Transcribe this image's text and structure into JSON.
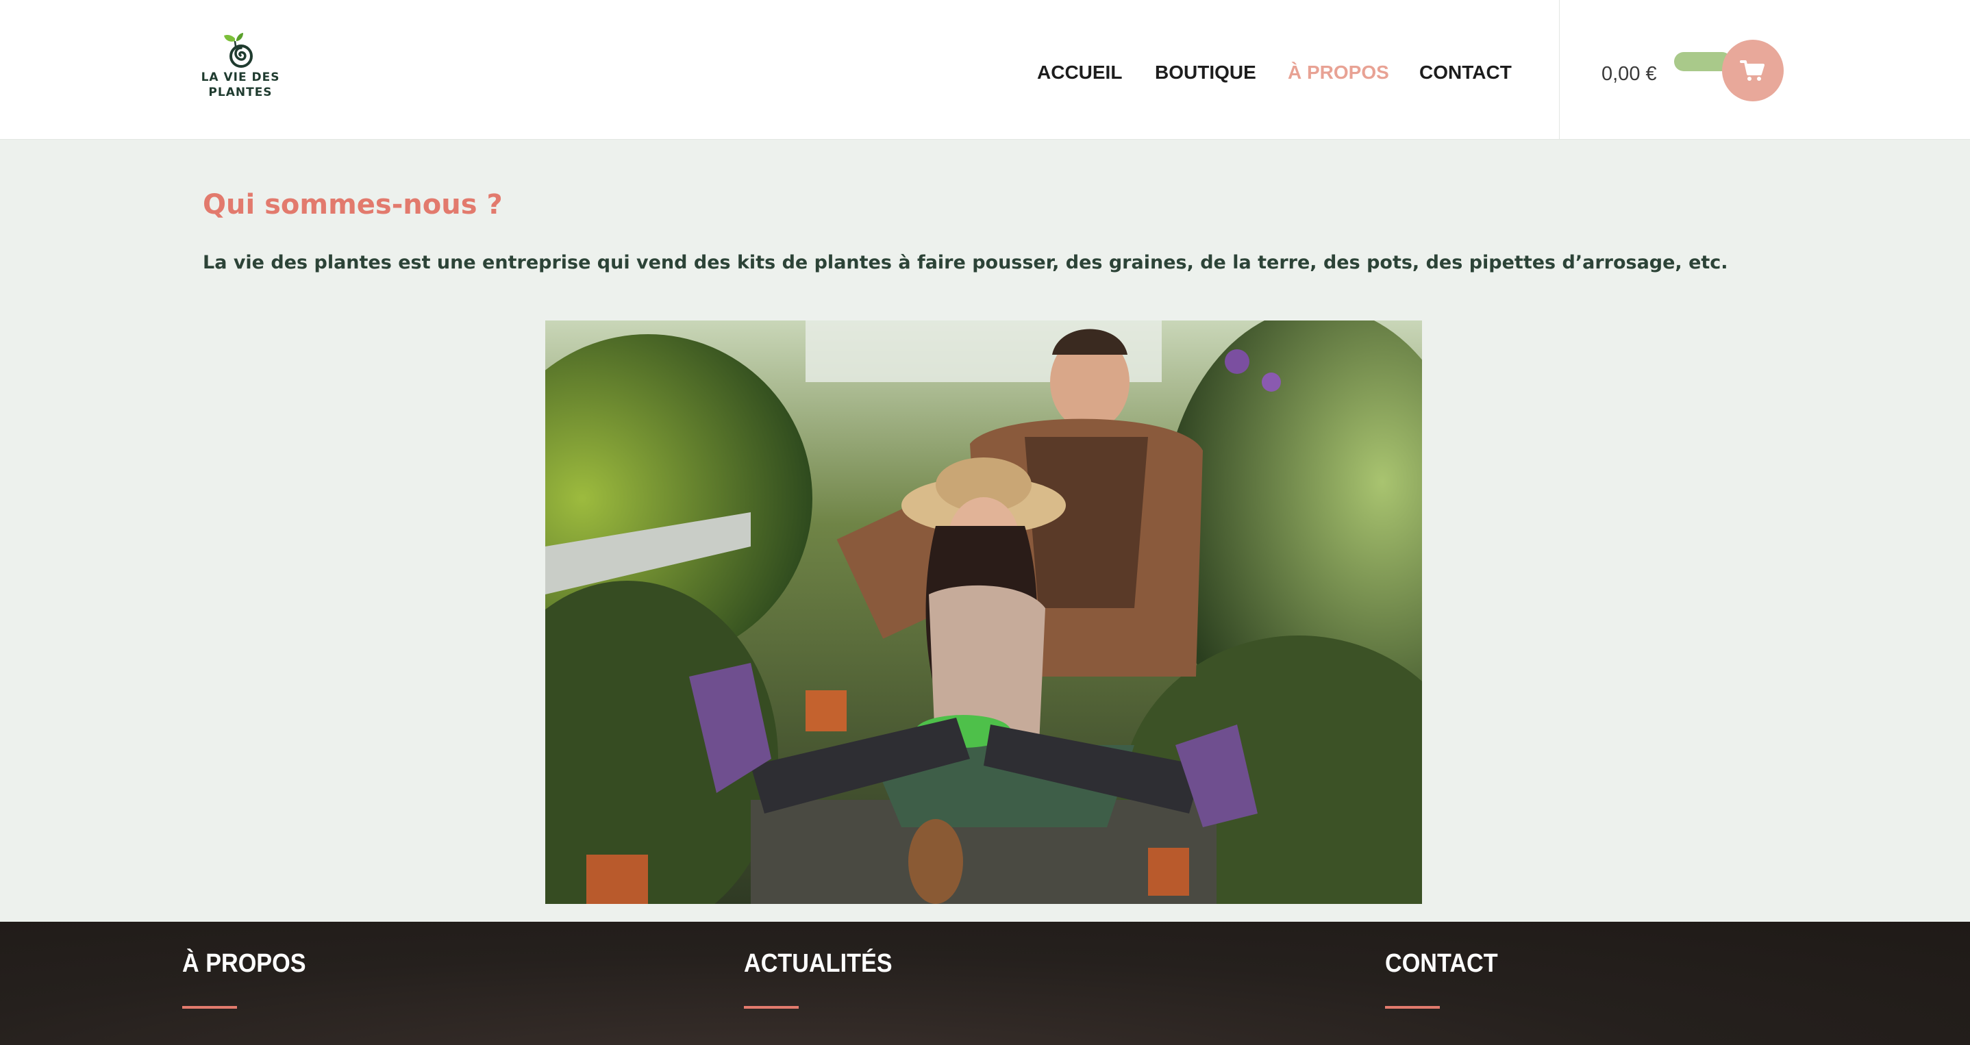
{
  "brand": {
    "logo_line1": "LA VIE DES",
    "logo_line2": "PLANTES",
    "colors": {
      "accent": "#e27a6d",
      "nav_active": "#e8a294",
      "dark_green": "#1f3b2f",
      "cart_button": "#e8a89a",
      "cart_pill": "#a9c98a"
    }
  },
  "nav": {
    "items": [
      {
        "label": "ACCUEIL",
        "active": false
      },
      {
        "label": "BOUTIQUE",
        "active": false
      },
      {
        "label": "À PROPOS",
        "active": true
      },
      {
        "label": "CONTACT",
        "active": false
      }
    ]
  },
  "cart": {
    "total": "0,00 €",
    "icon": "cart-icon"
  },
  "main": {
    "title": "Qui sommes-nous ?",
    "intro": "La vie des plantes est une entreprise qui vend des kits de plantes à faire pousser, des graines, de la terre, des pots, des pipettes d’arrosage, etc."
  },
  "footer": {
    "columns": [
      {
        "title": "À PROPOS"
      },
      {
        "title": "ACTUALITÉS"
      },
      {
        "title": "CONTACT"
      }
    ]
  }
}
